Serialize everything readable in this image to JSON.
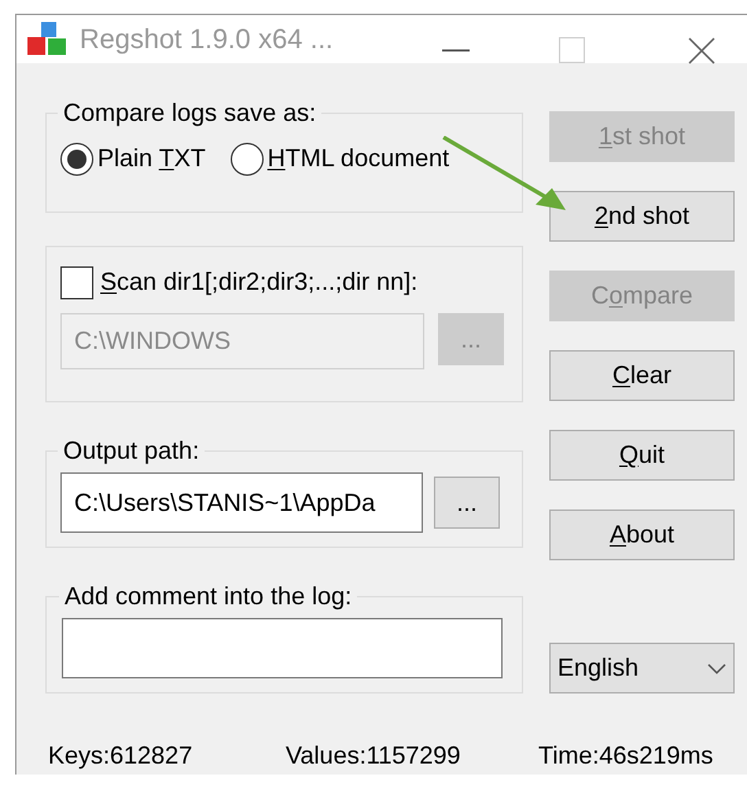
{
  "window": {
    "title": "Regshot 1.9.0 x64 ..."
  },
  "compare_group": {
    "legend": "Compare logs save as:",
    "options": [
      {
        "label": {
          "pre": "Plain ",
          "key": "T",
          "post": "XT"
        },
        "selected": true
      },
      {
        "label": {
          "key": "H",
          "post": "TML document"
        },
        "selected": false
      }
    ]
  },
  "scan_group": {
    "checkbox": {
      "label": {
        "key": "S",
        "post": "can dir1[;dir2;dir3;...;dir nn]:"
      },
      "checked": false
    },
    "field": {
      "value": "C:\\WINDOWS",
      "disabled": true
    },
    "browse": {
      "label": "...",
      "disabled": true
    }
  },
  "output_group": {
    "legend": "Output path:",
    "field": {
      "value": "C:\\Users\\STANIS~1\\AppDa",
      "disabled": false
    },
    "browse": {
      "label": "...",
      "disabled": false
    }
  },
  "comment_group": {
    "legend": "Add comment into the log:"
  },
  "buttons": [
    {
      "label": {
        "key": "1",
        "post": "st shot"
      },
      "disabled": true
    },
    {
      "label": {
        "key": "2",
        "post": "nd shot"
      },
      "disabled": false
    },
    {
      "label": {
        "pre": "C",
        "key": "o",
        "post": "mpare"
      },
      "disabled": true
    },
    {
      "label": {
        "key": "C",
        "post": "lear"
      },
      "disabled": false
    },
    {
      "label": {
        "key": "Q",
        "post": "uit"
      },
      "disabled": false
    },
    {
      "label": {
        "key": "A",
        "post": "bout"
      },
      "disabled": false
    }
  ],
  "language": {
    "value": "English"
  },
  "status_bar": [
    "Keys:612827",
    "Values:1157299",
    "Time:46s219ms"
  ]
}
